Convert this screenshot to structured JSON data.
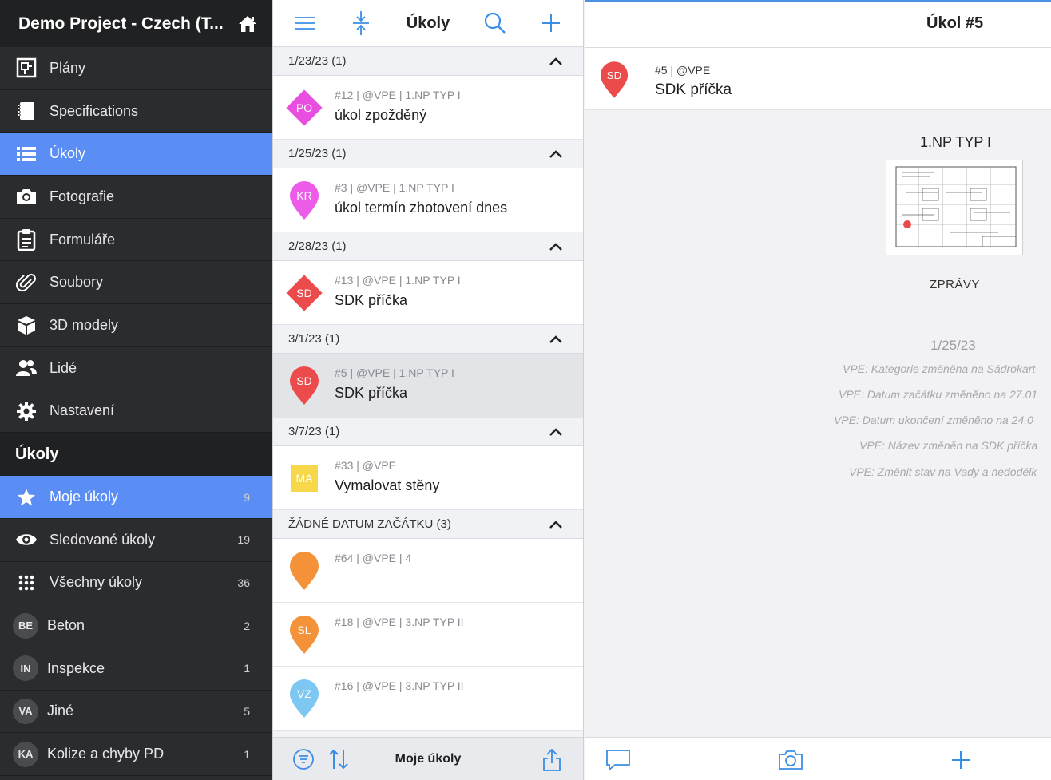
{
  "sidebar": {
    "project_title": "Demo Project - Czech (T...",
    "nav": [
      {
        "label": "Plány",
        "icon": "plans-icon"
      },
      {
        "label": "Specifications",
        "icon": "notebook-icon"
      },
      {
        "label": "Úkoly",
        "icon": "list-icon"
      },
      {
        "label": "Fotografie",
        "icon": "camera-icon"
      },
      {
        "label": "Formuláře",
        "icon": "clipboard-icon"
      },
      {
        "label": "Soubory",
        "icon": "paperclip-icon"
      },
      {
        "label": "3D modely",
        "icon": "cube-icon"
      },
      {
        "label": "Lidé",
        "icon": "people-icon"
      },
      {
        "label": "Nastavení",
        "icon": "gear-icon"
      }
    ],
    "section_title": "Úkoly",
    "filters": [
      {
        "label": "Moje úkoly",
        "count": "9",
        "icon": "star-icon"
      },
      {
        "label": "Sledované úkoly",
        "count": "19",
        "icon": "eye-icon"
      },
      {
        "label": "Všechny úkoly",
        "count": "36",
        "icon": "grid-icon"
      }
    ],
    "categories": [
      {
        "abbr": "BE",
        "label": "Beton",
        "count": "2"
      },
      {
        "abbr": "IN",
        "label": "Inspekce",
        "count": "1"
      },
      {
        "abbr": "VA",
        "label": "Jiné",
        "count": "5"
      },
      {
        "abbr": "KA",
        "label": "Kolize a chyby PD",
        "count": "1"
      }
    ]
  },
  "middle": {
    "title": "Úkoly",
    "groups": [
      {
        "header": "1/23/23 (1)",
        "tasks": [
          {
            "abbr": "PO",
            "meta": "#12 | @VPE | 1.NP TYP I",
            "name": "úkol zpožděný",
            "color": "#e84fe0",
            "shape": "diamond"
          }
        ]
      },
      {
        "header": "1/25/23 (1)",
        "tasks": [
          {
            "abbr": "KR",
            "meta": "#3 | @VPE | 1.NP TYP I",
            "name": "úkol termín zhotovení dnes",
            "color": "#ec5ce8",
            "shape": "pin"
          }
        ]
      },
      {
        "header": "2/28/23 (1)",
        "tasks": [
          {
            "abbr": "SD",
            "meta": "#13 | @VPE | 1.NP TYP I",
            "name": "SDK příčka",
            "color": "#ec4b4b",
            "shape": "diamond"
          }
        ]
      },
      {
        "header": "3/1/23 (1)",
        "tasks": [
          {
            "abbr": "SD",
            "meta": "#5 | @VPE | 1.NP TYP I",
            "name": "SDK příčka",
            "color": "#ec4b4b",
            "shape": "pin"
          }
        ]
      },
      {
        "header": "3/7/23 (1)",
        "tasks": [
          {
            "abbr": "MA",
            "meta": "#33 | @VPE",
            "name": "Vymalovat stěny",
            "color": "#f7d84a",
            "shape": "square"
          }
        ]
      },
      {
        "header": "ŽÁDNÉ DATUM ZAČÁTKU (3)",
        "tasks": [
          {
            "abbr": "",
            "meta": "#64 | @VPE | 4",
            "name": "",
            "color": "#f4923a",
            "shape": "pin"
          },
          {
            "abbr": "SL",
            "meta": "#18 | @VPE | 3.NP TYP II",
            "name": "",
            "color": "#f4923a",
            "shape": "pin"
          },
          {
            "abbr": "VZ",
            "meta": "#16 | @VPE | 3.NP TYP II",
            "name": "",
            "color": "#7cc8f2",
            "shape": "pin"
          }
        ]
      }
    ],
    "bottom_label": "Moje úkoly"
  },
  "detail": {
    "title": "Úkol #5",
    "task_abbr": "SD",
    "task_meta": "#5 | @VPE",
    "task_name": "SDK příčka",
    "plan_name": "1.NP TYP I",
    "messages_title": "ZPRÁVY",
    "message_date": "1/25/23",
    "messages": [
      "VPE: Kategorie změněna na Sádrokart",
      "VPE: Datum začátku změněno na 27.01",
      "VPE: Datum ukončení změněno na 24.0",
      "VPE: Název změněn na SDK příčka",
      "VPE: Změnit stav na Vady a nedodělk"
    ]
  },
  "colors": {
    "accent": "#5b8ef5",
    "ios_blue": "#3a8ee6",
    "sidebar_bg": "#2b2c2e"
  }
}
